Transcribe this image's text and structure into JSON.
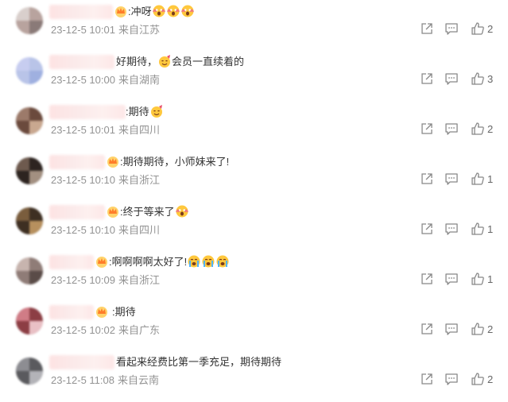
{
  "comments": [
    {
      "text": ":冲呀",
      "emojis": [
        "scream-face-icon",
        "scream-face-icon",
        "scream-face-icon"
      ],
      "date": "23-12-5 10:01",
      "location": "来自江苏",
      "likes": "2",
      "crown": true,
      "avatar_colors": [
        "#b8a39e",
        "#8a7a78",
        "#d9cfcc"
      ]
    },
    {
      "text": "好期待，",
      "text2": "会员一直续着的",
      "emojis": [
        "party-face-icon"
      ],
      "date": "23-12-5 10:00",
      "location": "来自湖南",
      "likes": "3",
      "crown": false,
      "avatar_colors": [
        "#b9c4e8",
        "#c7cdf0",
        "#9fb0e0"
      ]
    },
    {
      "text": ":期待",
      "emojis": [
        "party-face-icon"
      ],
      "date": "23-12-5 10:01",
      "location": "来自四川",
      "likes": "2",
      "crown": false,
      "avatar_colors": [
        "#6b4a3d",
        "#9c7a6a",
        "#c9a890"
      ]
    },
    {
      "text": ":期待期待，小师妹来了!",
      "emojis": [],
      "date": "23-12-5 10:10",
      "location": "来自浙江",
      "likes": "1",
      "crown": true,
      "avatar_colors": [
        "#2d2420",
        "#6e5a4e",
        "#a39081"
      ]
    },
    {
      "text": ":终于等来了",
      "emojis": [
        "scream-face-icon"
      ],
      "date": "23-12-5 10:10",
      "location": "来自四川",
      "likes": "1",
      "crown": true,
      "avatar_colors": [
        "#3e2f22",
        "#7a5d3d",
        "#b7905e"
      ]
    },
    {
      "text": ":啊啊啊啊太好了!",
      "emojis": [
        "crying-face-icon",
        "crying-face-icon",
        "crying-face-icon"
      ],
      "date": "23-12-5 10:09",
      "location": "来自浙江",
      "likes": "1",
      "crown": true,
      "avatar_colors": [
        "#8f7c77",
        "#c7b4ae",
        "#5a4c48"
      ]
    },
    {
      "text": ":期待",
      "emojis": [],
      "date": "23-12-5 10:02",
      "location": "来自广东",
      "likes": "2",
      "crown": true,
      "avatar_colors": [
        "#8c3e44",
        "#d07c86",
        "#e9c0c5"
      ]
    },
    {
      "text": "看起来经费比第一季充足，期待期待",
      "emojis": [],
      "date": "23-12-5 11:08",
      "location": "来自云南",
      "likes": "2",
      "crown": false,
      "avatar_colors": [
        "#5a5a5e",
        "#8d8d92",
        "#b3b3b8"
      ]
    }
  ]
}
